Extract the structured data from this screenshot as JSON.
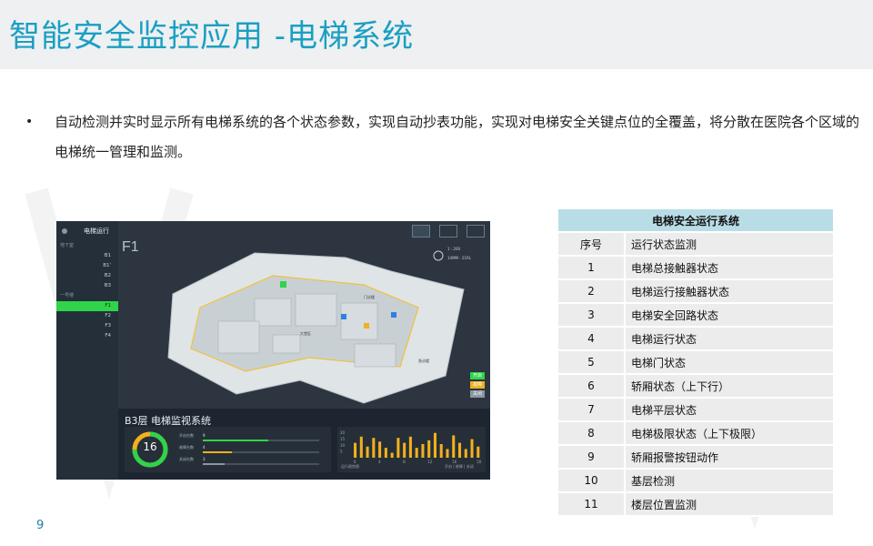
{
  "slide": {
    "title": "智能安全监控应用 -电梯系统",
    "bullet_text": "自动检测并实时显示所有电梯系统的各个状态参数，实现自动抄表功能，实现对电梯安全关键点位的全覆盖，将分散在医院各个区域的电梯统一管理和监测。",
    "page_number": "9"
  },
  "screenshot": {
    "sidebar_title": "电梯运行",
    "groups": [
      {
        "label": "地下室",
        "items": [
          "B1",
          "B1'",
          "B2",
          "B3"
        ]
      },
      {
        "label": "一号楼",
        "items": [
          "F1",
          "F2",
          "F3",
          "F4"
        ]
      }
    ],
    "active_item": "F1",
    "floor_label": "F1",
    "map_labels": [
      "大堂区",
      "门诊楼",
      "急诊楼"
    ],
    "stat_lines": [
      "1 : 200",
      "14MM : 21RL"
    ],
    "status_legend": [
      {
        "label": "开启",
        "color": "#2fd44a"
      },
      {
        "label": "故障",
        "color": "#f2b01e"
      },
      {
        "label": "关闭",
        "color": "#8a96a2"
      }
    ],
    "bottom_title": "B3层 电梯监视系统",
    "gauge_value": "16",
    "gauge_colors": {
      "track": "#f2b01e",
      "arc": "#2fd44a"
    },
    "status_bars": [
      {
        "label": "开启台数",
        "value": "9",
        "fraction": 0.56,
        "color": "#2fd44a"
      },
      {
        "label": "故障台数",
        "value": "4",
        "fraction": 0.25,
        "color": "#f2b01e"
      },
      {
        "label": "关闭台数",
        "value": "3",
        "fraction": 0.19,
        "color": "#8a96a2"
      }
    ],
    "chart_footer_left": "运行趋势图",
    "chart_footer_right": "开启 | 故障 | 关闭",
    "chart_data": {
      "type": "bar",
      "x_ticks": [
        "0",
        "4",
        "8",
        "12",
        "16",
        "20"
      ],
      "y_ticks": [
        "20",
        "15",
        "10",
        "5"
      ],
      "values": [
        12,
        17,
        9,
        16,
        13,
        8,
        4,
        16,
        12,
        17,
        8,
        11,
        14,
        20,
        11,
        7,
        18,
        12,
        7,
        15,
        9
      ],
      "ylim": [
        0,
        22
      ],
      "bar_color": "#f2b01e"
    }
  },
  "table": {
    "title": "电梯安全运行系统",
    "header_num": "序号",
    "header_item": "运行状态监测",
    "rows": [
      {
        "num": "1",
        "item": "电梯总接触器状态"
      },
      {
        "num": "2",
        "item": "电梯运行接触器状态"
      },
      {
        "num": "3",
        "item": "电梯安全回路状态"
      },
      {
        "num": "4",
        "item": "电梯运行状态"
      },
      {
        "num": "5",
        "item": "电梯门状态"
      },
      {
        "num": "6",
        "item": "轿厢状态（上下行）"
      },
      {
        "num": "7",
        "item": "电梯平层状态"
      },
      {
        "num": "8",
        "item": "电梯极限状态（上下极限）"
      },
      {
        "num": "9",
        "item": "轿厢报警按钮动作"
      },
      {
        "num": "10",
        "item": "基层检测"
      },
      {
        "num": "11",
        "item": "楼层位置监测"
      }
    ]
  }
}
